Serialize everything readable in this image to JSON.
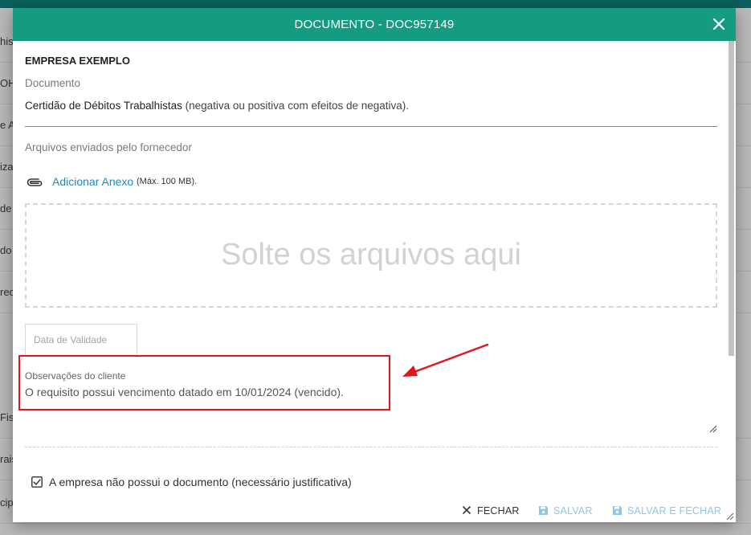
{
  "background": {
    "rows": [
      "his",
      "OH",
      "e A",
      "iza",
      "de A",
      "do",
      "rece",
      "Fis",
      "rais",
      "cipa"
    ]
  },
  "dialog": {
    "title": "DOCUMENTO - DOC957149",
    "company": "EMPRESA EXEMPLO",
    "document_caption": "Documento",
    "document_name": "Certidão de Débitos Trabalhistas",
    "document_detail": " (negativa ou positiva com efeitos de negativa).",
    "files_caption": "Arquivos enviados pelo fornecedor",
    "attach_link": "Adicionar Anexo",
    "attach_note": "(Máx. 100 MB).",
    "dropzone_text": "Solte os arquivos aqui",
    "date_placeholder": "Data de Validade",
    "observations_label": "Observações do cliente",
    "observations_text": "O requisito possui vencimento datado em 10/01/2024 (vencido).",
    "checkbox_label": "A empresa não possui o documento (necessário justificativa)",
    "checkbox_checked": true,
    "buttons": {
      "close": "FECHAR",
      "save": "SALVAR",
      "save_close": "SALVAR E FECHAR"
    }
  },
  "colors": {
    "header": "#169b83",
    "link": "#1e88c7",
    "highlight": "#e0161d",
    "disabled_button": "#8cc7e6"
  },
  "icons": [
    "close-icon",
    "paperclip-icon",
    "checkbox-checked-icon",
    "close-x-icon",
    "save-icon",
    "resize-handle-icon"
  ]
}
